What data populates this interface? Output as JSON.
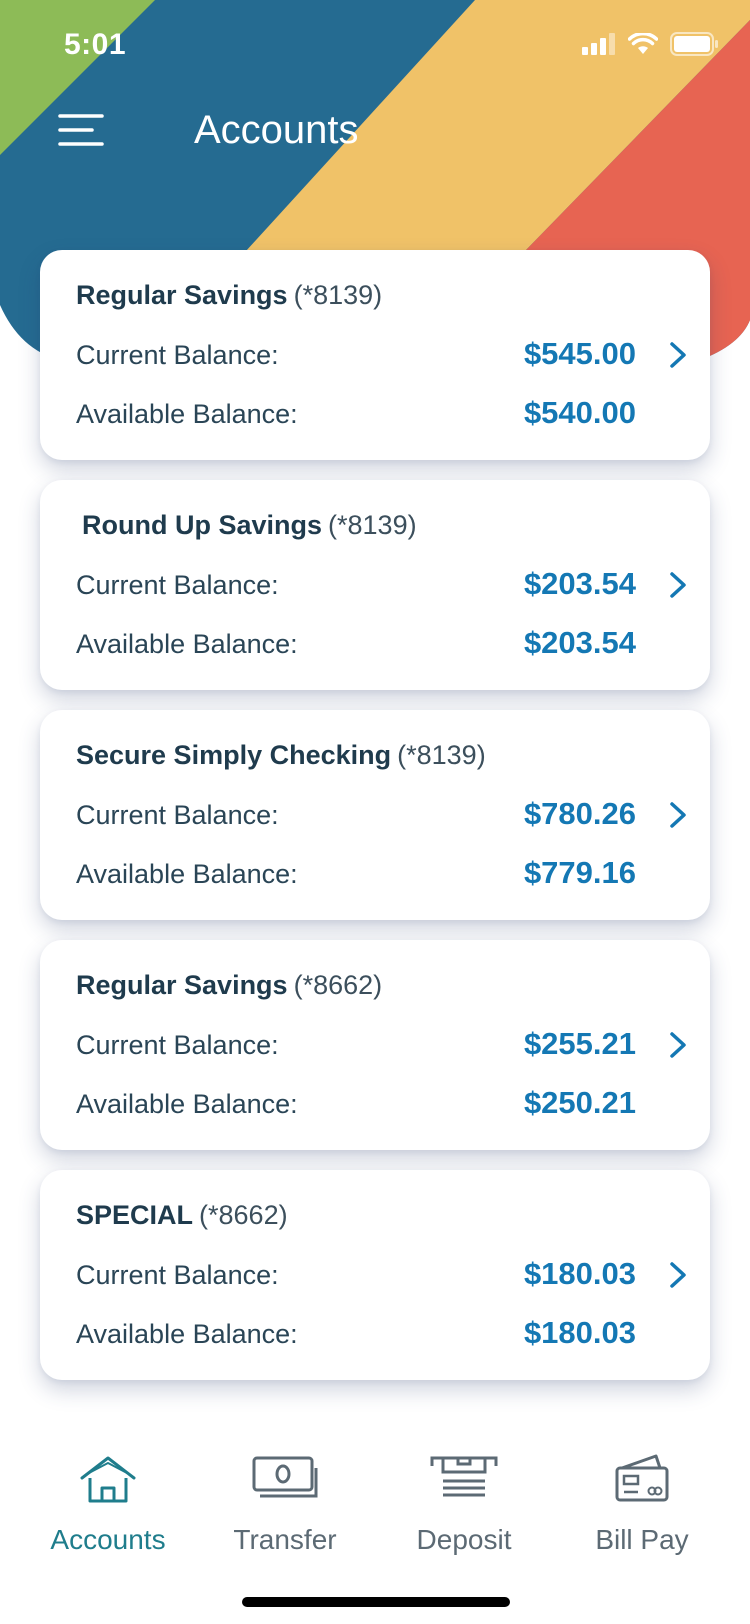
{
  "status_bar": {
    "time": "5:01"
  },
  "header": {
    "title": "Accounts"
  },
  "accounts": [
    {
      "name": "Regular Savings",
      "number": "(*8139)",
      "current_label": "Current Balance:",
      "current": "$545.00",
      "available_label": "Available Balance:",
      "available": "$540.00"
    },
    {
      "name": "Round Up Savings",
      "number": "(*8139)",
      "current_label": "Current Balance:",
      "current": "$203.54",
      "available_label": "Available Balance:",
      "available": "$203.54"
    },
    {
      "name": "Secure Simply Checking",
      "number": "(*8139)",
      "current_label": "Current Balance:",
      "current": "$780.26",
      "available_label": "Available Balance:",
      "available": "$779.16"
    },
    {
      "name": "Regular Savings",
      "number": "(*8662)",
      "current_label": "Current Balance:",
      "current": "$255.21",
      "available_label": "Available Balance:",
      "available": "$250.21"
    },
    {
      "name": "SPECIAL",
      "number": "(*8662)",
      "current_label": "Current Balance:",
      "current": "$180.03",
      "available_label": "Available Balance:",
      "available": "$180.03"
    }
  ],
  "nav": {
    "items": [
      {
        "label": "Accounts",
        "icon": "home-icon",
        "active": true
      },
      {
        "label": "Transfer",
        "icon": "money-transfer-icon",
        "active": false
      },
      {
        "label": "Deposit",
        "icon": "deposit-icon",
        "active": false
      },
      {
        "label": "Bill Pay",
        "icon": "bill-pay-card-icon",
        "active": false
      }
    ]
  },
  "colors": {
    "header_green": "#8dbb57",
    "header_blue": "#256b91",
    "header_yellow": "#f0c268",
    "header_red": "#e76452",
    "balance_blue": "#1478b4",
    "nav_active": "#1f7d8c"
  }
}
